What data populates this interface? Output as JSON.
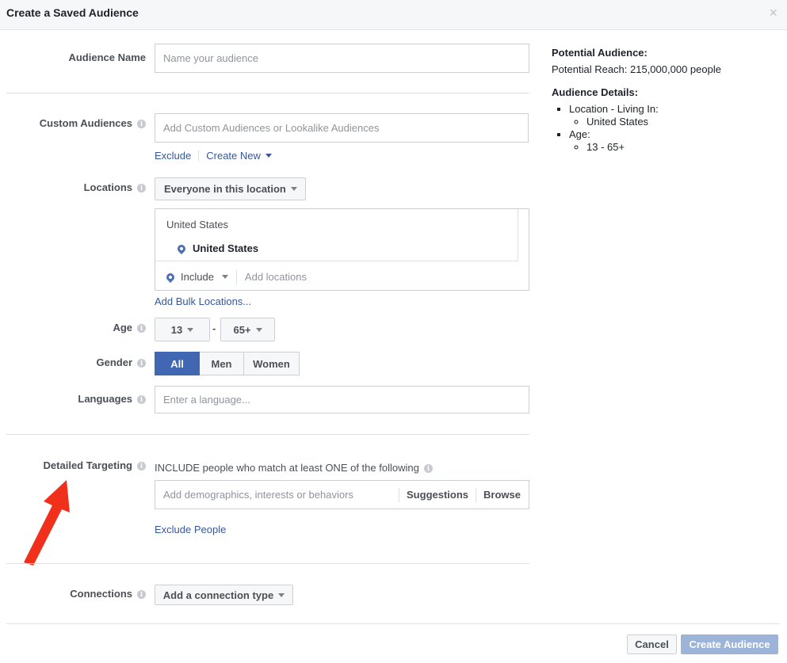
{
  "dialog": {
    "title": "Create a Saved Audience",
    "close_glyph": "×"
  },
  "audience_name": {
    "label": "Audience Name",
    "placeholder": "Name your audience"
  },
  "custom_audiences": {
    "label": "Custom Audiences",
    "placeholder": "Add Custom Audiences or Lookalike Audiences",
    "exclude_link": "Exclude",
    "create_new_link": "Create New"
  },
  "locations": {
    "label": "Locations",
    "dropdown_value": "Everyone in this location",
    "group_header": "United States",
    "selected_location": "United States",
    "include_value": "Include",
    "add_placeholder": "Add locations",
    "bulk_link": "Add Bulk Locations..."
  },
  "age": {
    "label": "Age",
    "min": "13",
    "separator": "-",
    "max": "65+"
  },
  "gender": {
    "label": "Gender",
    "options": [
      "All",
      "Men",
      "Women"
    ],
    "selected": "All"
  },
  "languages": {
    "label": "Languages",
    "placeholder": "Enter a language..."
  },
  "detailed_targeting": {
    "label": "Detailed Targeting",
    "include_text": "INCLUDE people who match at least ONE of the following",
    "placeholder": "Add demographics, interests or behaviors",
    "suggestions": "Suggestions",
    "browse": "Browse",
    "exclude_link": "Exclude People"
  },
  "connections": {
    "label": "Connections",
    "dropdown_value": "Add a connection type"
  },
  "footer": {
    "cancel": "Cancel",
    "create": "Create Audience"
  },
  "sidebar": {
    "potential_title": "Potential Audience:",
    "reach": "Potential Reach: 215,000,000 people",
    "details_title": "Audience Details:",
    "location_item": "Location - Living In:",
    "location_value": "United States",
    "age_item": "Age:",
    "age_value": "13 - 65+"
  },
  "colors": {
    "brand_blue": "#4267b2",
    "link_blue": "#365899",
    "arrow_red": "#f0301a",
    "disabled_blue": "#9cb4d8"
  }
}
